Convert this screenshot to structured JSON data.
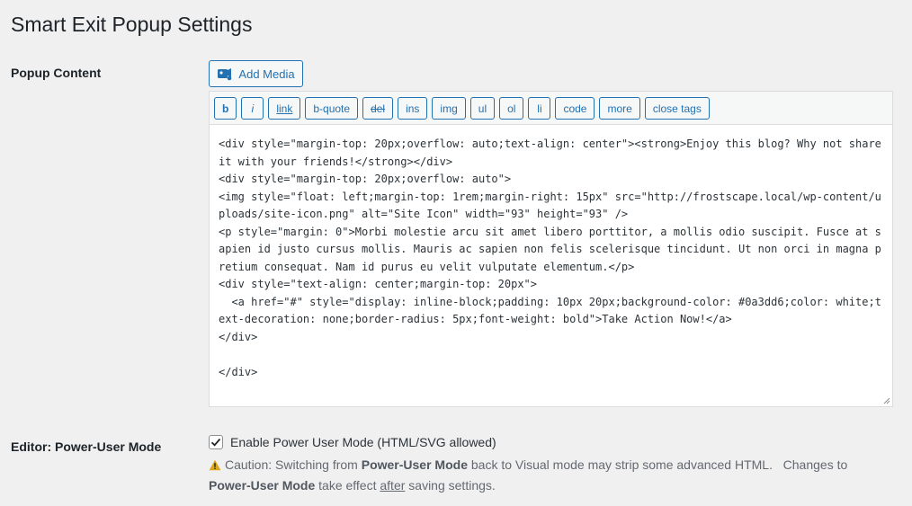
{
  "page": {
    "title": "Smart Exit Popup Settings"
  },
  "popup_content": {
    "label": "Popup Content",
    "add_media_label": "Add Media",
    "quicktags": [
      "b",
      "i",
      "link",
      "b-quote",
      "del",
      "ins",
      "img",
      "ul",
      "ol",
      "li",
      "code",
      "more",
      "close tags"
    ],
    "code": "<div style=\"margin-top: 20px;overflow: auto;text-align: center\"><strong>Enjoy this blog? Why not share it with your friends!</strong></div>\n<div style=\"margin-top: 20px;overflow: auto\">\n<img style=\"float: left;margin-top: 1rem;margin-right: 15px\" src=\"http://frostscape.local/wp-content/uploads/site-icon.png\" alt=\"Site Icon\" width=\"93\" height=\"93\" />\n<p style=\"margin: 0\">Morbi molestie arcu sit amet libero porttitor, a mollis odio suscipit. Fusce at sapien id justo cursus mollis. Mauris ac sapien non felis scelerisque tincidunt. Ut non orci in magna pretium consequat. Nam id purus eu velit vulputate elementum.</p>\n<div style=\"text-align: center;margin-top: 20px\">\n  <a href=\"#\" style=\"display: inline-block;padding: 10px 20px;background-color: #0a3dd6;color: white;text-decoration: none;border-radius: 5px;font-weight: bold\">Take Action Now!</a>\n</div>\n\n</div>"
  },
  "power_user": {
    "label": "Editor: Power-User Mode",
    "checkbox_label": "Enable Power User Mode (HTML/SVG allowed)",
    "checked": true,
    "caution_prefix": "Caution: Switching from ",
    "caution_bold1": "Power-User Mode",
    "caution_mid": " back to Visual mode may strip some advanced HTML.   Changes to ",
    "caution_bold2": "Power-User Mode",
    "caution_mid2": " take effect ",
    "caution_underlined": "after",
    "caution_suffix": " saving settings."
  },
  "colors": {
    "accent": "#2271b1",
    "background": "#f0f0f1",
    "warning": "#dba617"
  }
}
